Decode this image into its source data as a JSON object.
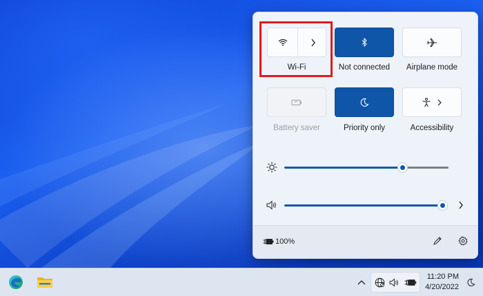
{
  "quick_settings": {
    "wifi": {
      "label": "Wi-Fi",
      "icon": "wifi-icon",
      "chevron": "chevron-right-icon"
    },
    "bluetooth": {
      "label": "Not connected",
      "icon": "bluetooth-icon"
    },
    "airplane": {
      "label": "Airplane mode",
      "icon": "airplane-icon"
    },
    "battery_saver": {
      "label": "Battery saver",
      "icon": "battery-saver-icon",
      "disabled": true
    },
    "focus": {
      "label": "Priority only",
      "icon": "moon-icon"
    },
    "accessibility": {
      "label": "Accessibility",
      "icon": "accessibility-icon",
      "chevron": "chevron-right-icon"
    },
    "brightness": {
      "icon": "brightness-icon",
      "level": 0.72
    },
    "volume": {
      "icon": "speaker-icon",
      "level": 1.0
    },
    "footer": {
      "battery_percent": "100%",
      "battery_icon": "battery-charging-icon",
      "edit_icon": "pencil-icon",
      "settings_icon": "gear-icon"
    }
  },
  "taskbar": {
    "apps": [
      {
        "name": "Microsoft Edge",
        "icon": "edge-icon"
      },
      {
        "name": "File Explorer",
        "icon": "folder-icon"
      }
    ],
    "tray_overflow_icon": "chevron-up-icon",
    "tray_icons": [
      "globe-icon",
      "speaker-icon",
      "battery-charging-icon"
    ],
    "time": "11:20 PM",
    "date": "4/20/2022",
    "notifications_icon": "moon-icon"
  },
  "colors": {
    "accent": "#0f56a8",
    "highlight_box": "#e0191f",
    "panel": "#eef2f9",
    "taskbar": "#dde5f1"
  }
}
